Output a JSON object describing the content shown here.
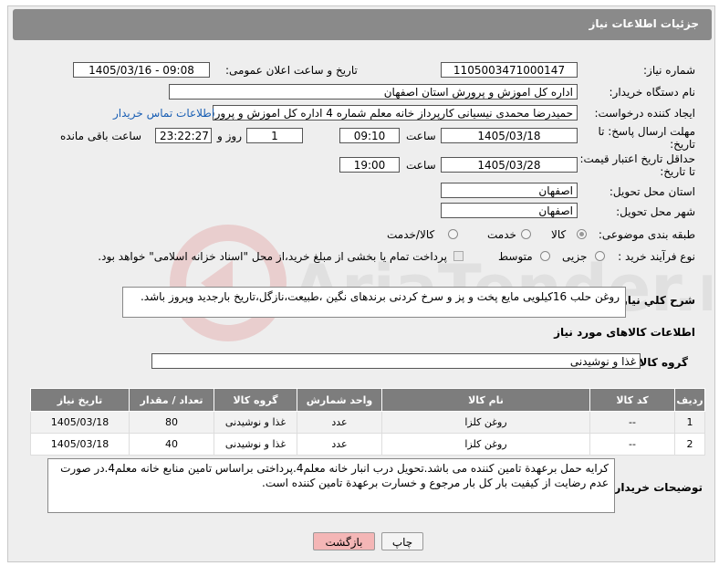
{
  "header": {
    "title": "جزئیات اطلاعات نیاز"
  },
  "fields": {
    "need_number_label": "شماره نیاز:",
    "need_number": "1105003471000147",
    "announce_label": "تاریخ و ساعت اعلان عمومی:",
    "announce_value": "1405/03/16 - 09:08",
    "buyer_org_label": "نام دستگاه خریدار:",
    "buyer_org": "اداره کل اموزش و پرورش استان اصفهان",
    "creator_label": "ایجاد کننده درخواست:",
    "creator": "حمیدرضا محمدی نیسیانی کارپرداز خانه معلم شماره 4 اداره کل اموزش و پرورش",
    "contact_link": "اطلاعات تماس خریدار",
    "deadline_label_1": "مهلت ارسال پاسخ: تا",
    "deadline_label_2": "تاریخ:",
    "deadline_date": "1405/03/18",
    "hour_label": "ساعت",
    "deadline_time": "09:10",
    "days_value": "1",
    "days_label": "روز و",
    "remaining_value": "23:22:27",
    "remaining_label": "ساعت باقی مانده",
    "validity_label_1": "حداقل تاریخ اعتبار قیمت:",
    "validity_label_2": "تا تاریخ:",
    "validity_date": "1405/03/28",
    "validity_time": "19:00",
    "province_label": "استان محل تحویل:",
    "province": "اصفهان",
    "city_label": "شهر محل تحویل:",
    "city": "اصفهان",
    "category_label": "طبقه بندی موضوعی:",
    "category_options": [
      "کالا",
      "خدمت",
      "کالا/خدمت"
    ],
    "category_selected": "کالا",
    "process_label": "نوع فرآیند خرید :",
    "process_options": [
      "جزیی",
      "متوسط"
    ],
    "process_note": "پرداخت تمام یا بخشی از مبلغ خرید،از محل \"اسناد خزانه اسلامی\" خواهد بود."
  },
  "description": {
    "label": "شرح کلي نياز:",
    "text": "روغن حلب 16کیلویی مایع پخت و پز و سرخ کردنی برندهای نگین ،طبیعت،نازگل،تاریخ بارجدید وپروز باشد."
  },
  "goods_section": {
    "title": "اطلاعات کالاهای مورد نیاز",
    "group_label": "گروه کالا:",
    "group_value": "غذا و نوشیدنی"
  },
  "table": {
    "headers": [
      "ردیف",
      "کد کالا",
      "نام کالا",
      "واحد شمارش",
      "گروه کالا",
      "تعداد / مقدار",
      "تاریخ نیاز"
    ],
    "rows": [
      [
        "1",
        "--",
        "روغن کلزا",
        "عدد",
        "غذا و نوشیدنی",
        "80",
        "1405/03/18"
      ],
      [
        "2",
        "--",
        "روغن کلزا",
        "عدد",
        "غذا و نوشیدنی",
        "40",
        "1405/03/18"
      ]
    ]
  },
  "buyer_notes": {
    "label": "توضیحات خریدار:",
    "text": "کرایه حمل برعهدة تامین کننده می باشد.تحویل درب انبار خانه معلم4.پرداختی براساس تامین منابع خانه معلم4.در صورت عدم رضایت از کیفیت بار کل بار مرجوع و خسارت برعهدة تامین کننده است."
  },
  "buttons": {
    "print": "چاپ",
    "back": "بازگشت"
  },
  "watermark": {
    "text": "AriaTender.net"
  },
  "colors": {
    "header_bg": "#8a8a8a",
    "table_header_bg": "#7d7d7d",
    "link": "#1a5fb4",
    "back_button_bg": "#f4b6b6"
  }
}
